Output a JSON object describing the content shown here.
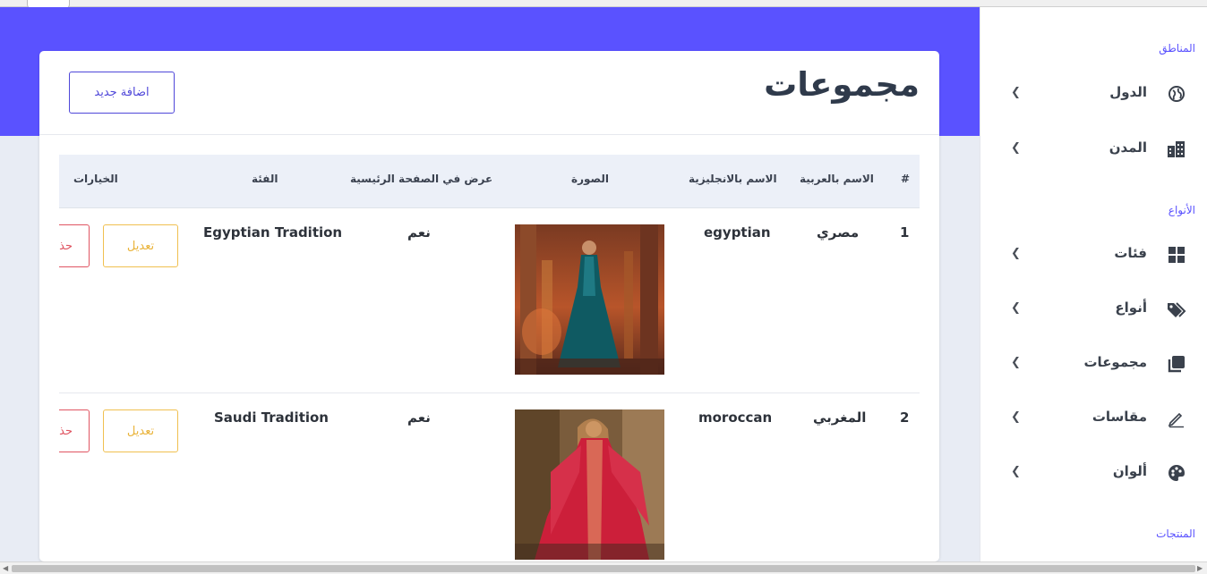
{
  "page": {
    "title": "مجموعات",
    "add_button": "اضافة جديد"
  },
  "table": {
    "headers": {
      "index": "#",
      "name_ar": "الاسم بالعربية",
      "name_en": "الاسم بالانجليزية",
      "image": "الصورة",
      "show_home": "عرض في الصفحة الرئيسية",
      "category": "الفئة",
      "options": "الخيارات"
    },
    "rows": [
      {
        "index": "1",
        "name_ar": "مصري",
        "name_en": "egyptian",
        "show_home": "نعم",
        "category": "Egyptian Tradition",
        "edit": "تعديل",
        "delete": "حذف"
      },
      {
        "index": "2",
        "name_ar": "المغربي",
        "name_en": "moroccan",
        "show_home": "نعم",
        "category": "Saudi Tradition",
        "edit": "تعديل",
        "delete": "حذف"
      }
    ]
  },
  "sidebar": {
    "sections": [
      "المناطق",
      "الأنواع",
      "المنتجات"
    ],
    "items": [
      {
        "label": "الدول",
        "icon": "globe-icon"
      },
      {
        "label": "المدن",
        "icon": "city-icon"
      },
      {
        "label": "فئات",
        "icon": "grid-icon"
      },
      {
        "label": "أنواع",
        "icon": "tags-icon"
      },
      {
        "label": "مجموعات",
        "icon": "layers-icon"
      },
      {
        "label": "مقاسات",
        "icon": "pencil-icon"
      },
      {
        "label": "ألوان",
        "icon": "palette-icon"
      }
    ]
  },
  "colors": {
    "accent": "#5a52ff",
    "edit": "#f0c050",
    "delete": "#e05562"
  }
}
